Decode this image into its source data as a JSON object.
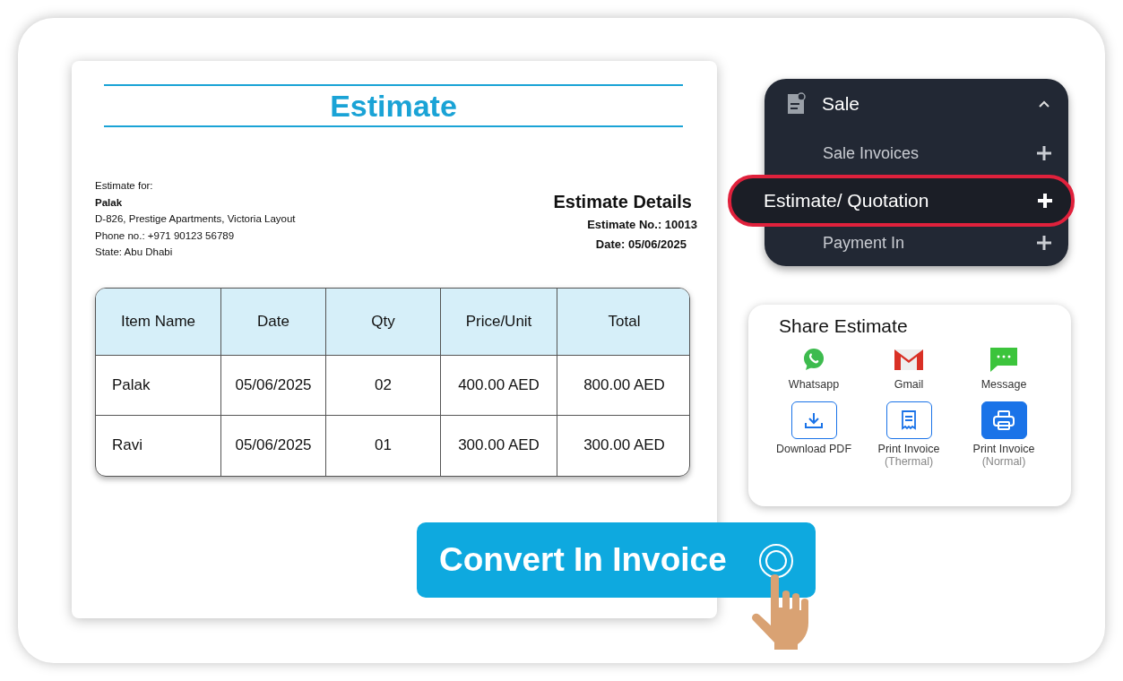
{
  "estimate": {
    "title": "Estimate",
    "bill_to": {
      "label": "Estimate for:",
      "name": "Palak",
      "address": "D-826, Prestige Apartments, Victoria Layout",
      "phone": "Phone no.: +971 90123 56789",
      "state": "State: Abu Dhabi"
    },
    "details": {
      "title": "Estimate Details",
      "number": "Estimate No.: 10013",
      "date": "Date: 05/06/2025"
    },
    "table": {
      "columns": [
        "Item Name",
        "Date",
        "Qty",
        "Price/Unit",
        "Total"
      ],
      "rows": [
        [
          "Palak",
          "05/06/2025",
          "02",
          "400.00 AED",
          "800.00 AED"
        ],
        [
          "Ravi",
          "05/06/2025",
          "01",
          "300.00 AED",
          "300.00 AED"
        ]
      ]
    }
  },
  "menu": {
    "title": "Sale",
    "expanded": true,
    "items": [
      {
        "label": "Sale Invoices",
        "selected": false
      },
      {
        "label": "Estimate/ Quotation",
        "selected": true
      },
      {
        "label": "Payment In",
        "selected": false
      }
    ]
  },
  "share": {
    "title": "Share Estimate",
    "options": [
      {
        "kind": "whatsapp",
        "label": "Whatsapp"
      },
      {
        "kind": "gmail",
        "label": "Gmail"
      },
      {
        "kind": "message",
        "label": "Message"
      },
      {
        "kind": "download",
        "label": "Download PDF",
        "selected": false
      },
      {
        "kind": "receipt",
        "label": "Print Invoice",
        "sublabel": "(Thermal)",
        "selected": false
      },
      {
        "kind": "printer",
        "label": "Print Invoice",
        "sublabel": "(Normal)",
        "selected": true
      }
    ]
  },
  "convert_button": {
    "label": "Convert In Invoice"
  }
}
